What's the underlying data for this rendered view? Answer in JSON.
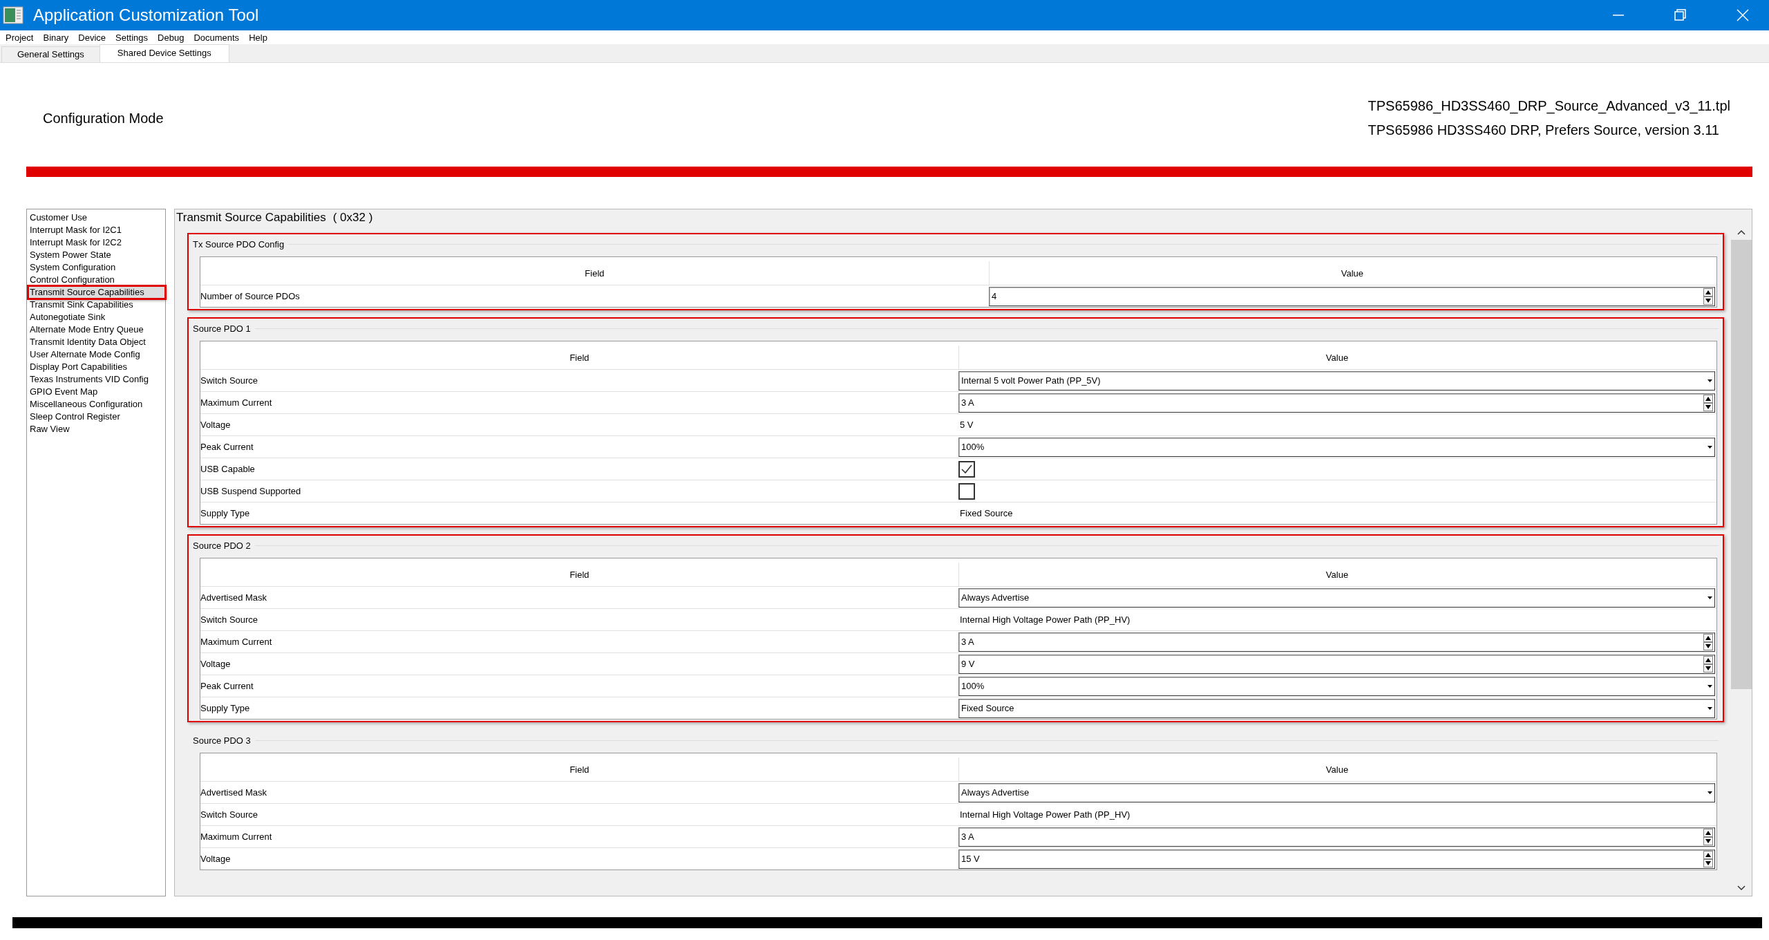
{
  "window": {
    "title": "Application Customization Tool"
  },
  "menu": [
    "Project",
    "Binary",
    "Device",
    "Settings",
    "Debug",
    "Documents",
    "Help"
  ],
  "tabs": [
    {
      "label": "General Settings",
      "selected": false
    },
    {
      "label": "Shared Device Settings",
      "selected": true
    }
  ],
  "header": {
    "mode": "Configuration Mode",
    "file_name": "TPS65986_HD3SS460_DRP_Source_Advanced_v3_11.tpl",
    "description": "TPS65986 HD3SS460 DRP, Prefers Source, version 3.11"
  },
  "sidebar": {
    "items": [
      {
        "label": "Customer Use",
        "selected": false,
        "highlighted": false
      },
      {
        "label": "Interrupt Mask for I2C1",
        "selected": false,
        "highlighted": false
      },
      {
        "label": "Interrupt Mask for I2C2",
        "selected": false,
        "highlighted": false
      },
      {
        "label": "System Power State",
        "selected": false,
        "highlighted": false
      },
      {
        "label": "System Configuration",
        "selected": false,
        "highlighted": false
      },
      {
        "label": "Control Configuration",
        "selected": false,
        "highlighted": false
      },
      {
        "label": "Transmit Source Capabilities",
        "selected": true,
        "highlighted": true
      },
      {
        "label": "Transmit Sink Capabilities",
        "selected": false,
        "highlighted": false
      },
      {
        "label": "Autonegotiate Sink",
        "selected": false,
        "highlighted": false
      },
      {
        "label": "Alternate Mode Entry Queue",
        "selected": false,
        "highlighted": false
      },
      {
        "label": "Transmit Identity Data Object",
        "selected": false,
        "highlighted": false
      },
      {
        "label": "User Alternate Mode Config",
        "selected": false,
        "highlighted": false
      },
      {
        "label": "Display Port Capabilities",
        "selected": false,
        "highlighted": false
      },
      {
        "label": "Texas Instruments VID Config",
        "selected": false,
        "highlighted": false
      },
      {
        "label": "GPIO Event Map",
        "selected": false,
        "highlighted": false
      },
      {
        "label": "Miscellaneous Configuration",
        "selected": false,
        "highlighted": false
      },
      {
        "label": "Sleep Control Register",
        "selected": false,
        "highlighted": false
      },
      {
        "label": "Raw View",
        "selected": false,
        "highlighted": false
      }
    ]
  },
  "panel": {
    "title": "Transmit Source Capabilities",
    "code": "( 0x32 )",
    "groups": [
      {
        "title": "Tx Source PDO Config",
        "highlighted": true,
        "columns": [
          "Field",
          "Value"
        ],
        "rows": [
          {
            "field": "Number of Source PDOs",
            "kind": "spinner",
            "value": "4"
          }
        ]
      },
      {
        "title": "Source PDO 1",
        "highlighted": true,
        "columns": [
          "Field",
          "Value"
        ],
        "rows": [
          {
            "field": "Switch Source",
            "kind": "dropdown",
            "value": "Internal 5 volt Power Path (PP_5V)"
          },
          {
            "field": "Maximum Current",
            "kind": "spinner",
            "value": "3 A"
          },
          {
            "field": "Voltage",
            "kind": "text",
            "value": "5 V"
          },
          {
            "field": "Peak Current",
            "kind": "dropdown",
            "value": "100%"
          },
          {
            "field": "USB Capable",
            "kind": "checkbox",
            "checked": true
          },
          {
            "field": "USB Suspend Supported",
            "kind": "checkbox",
            "checked": false
          },
          {
            "field": "Supply Type",
            "kind": "text",
            "value": "Fixed Source"
          }
        ]
      },
      {
        "title": "Source PDO 2",
        "highlighted": true,
        "columns": [
          "Field",
          "Value"
        ],
        "rows": [
          {
            "field": "Advertised Mask",
            "kind": "dropdown",
            "value": "Always Advertise"
          },
          {
            "field": "Switch Source",
            "kind": "text",
            "value": "Internal High Voltage Power Path (PP_HV)"
          },
          {
            "field": "Maximum Current",
            "kind": "spinner",
            "value": "3 A"
          },
          {
            "field": "Voltage",
            "kind": "spinner",
            "value": "9 V"
          },
          {
            "field": "Peak Current",
            "kind": "dropdown",
            "value": "100%"
          },
          {
            "field": "Supply Type",
            "kind": "dropdown",
            "value": "Fixed Source"
          }
        ]
      },
      {
        "title": "Source PDO 3",
        "highlighted": false,
        "columns": [
          "Field",
          "Value"
        ],
        "rows": [
          {
            "field": "Advertised Mask",
            "kind": "dropdown",
            "value": "Always Advertise"
          },
          {
            "field": "Switch Source",
            "kind": "text",
            "value": "Internal High Voltage Power Path (PP_HV)"
          },
          {
            "field": "Maximum Current",
            "kind": "spinner",
            "value": "3 A"
          },
          {
            "field": "Voltage",
            "kind": "spinner",
            "value": "15 V"
          }
        ]
      }
    ]
  }
}
